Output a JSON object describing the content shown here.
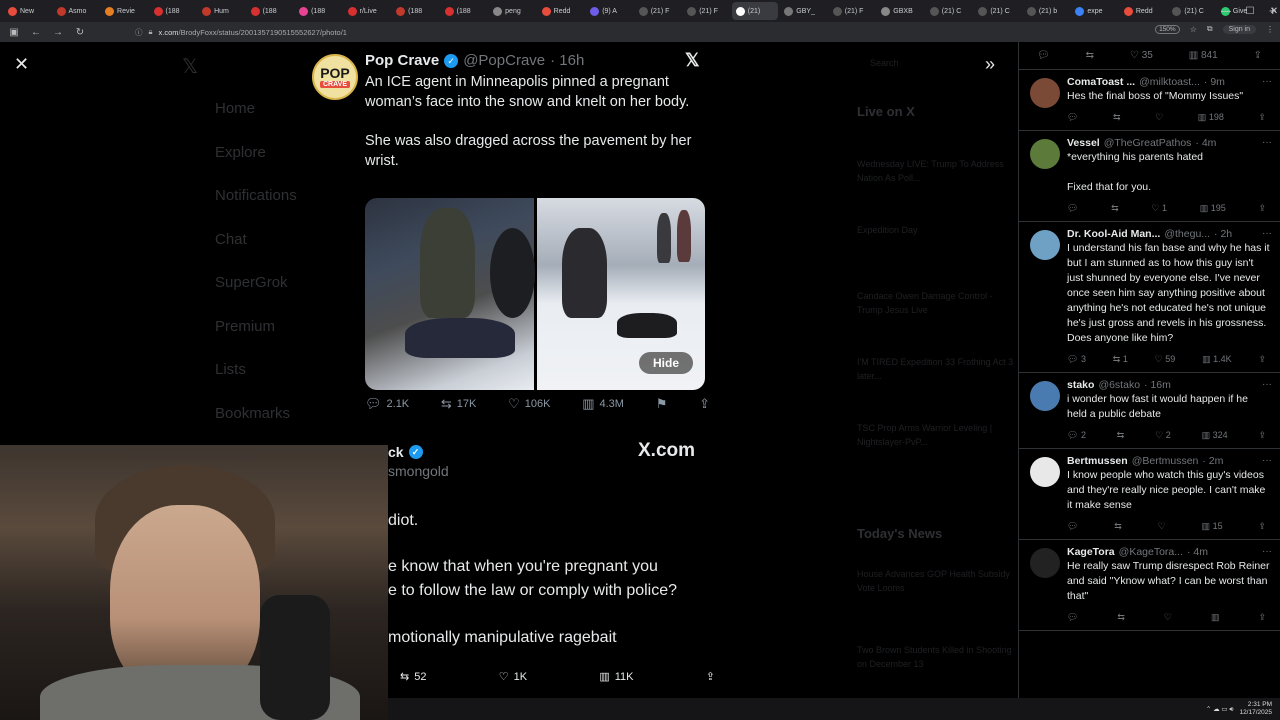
{
  "browser": {
    "tabs": [
      "New",
      "Asmo",
      "Revie",
      "(188",
      "Hum",
      "(188",
      "(188",
      "r/Live",
      "(188",
      "(188",
      "peng",
      "Redd",
      "(9) A",
      "(21) F",
      "(21) F",
      "(21)",
      "GBY_",
      "(21) F",
      "GBXB",
      "(21) C",
      "(21) C",
      "(21) b",
      "expe",
      "Redd",
      "(21) C",
      "Give"
    ],
    "active_tab_index": 15,
    "url_domain": "x.com",
    "url_path": "/BrodyFoxx/status/2001357190515552627/photo/1",
    "zoom": "150%",
    "signin_label": "Sign in"
  },
  "background": {
    "nav_items": [
      "Home",
      "Explore",
      "Notifications",
      "Chat",
      "SuperGrok",
      "Premium",
      "Lists",
      "Bookmarks"
    ],
    "search_label": "Search",
    "live_heading": "Live on X",
    "live_items": [
      "Wednesday LIVE: Trump To Address Nation As Poll...",
      "Expedition Day",
      "Candace Owen Damage Control - Trump Jesus Live",
      "I'M TIRED Expedition 33 Frothing Act 3 later...",
      "TSC Prop Arms Warrior Leveling | Nightslayer-PvP..."
    ],
    "news_heading": "Today's News",
    "news_items": [
      "House Advances GOP Health Subsidy Vote Looms",
      "Two Brown Students Killed in Shooting on December 13"
    ]
  },
  "tweet": {
    "name": "Pop Crave",
    "handle": "@PopCrave",
    "time": "· 16h",
    "avatar_text": "POP",
    "avatar_sub": "CRAVE",
    "text_1": "An ICE agent in Minneapolis pinned a pregnant woman’s face into the snow and knelt on her body.",
    "text_2": "She was also dragged across the pavement by her wrist.",
    "hide_label": "Hide",
    "replies": "2.1K",
    "reposts": "17K",
    "likes": "106K",
    "views": "4.3M"
  },
  "quote": {
    "name_fragment": "ck",
    "handle_fragment": "smongold",
    "brand": "X.com",
    "line1": "diot.",
    "line2": "e know that when you're pregnant you",
    "line3": "e to follow the law or comply with police?",
    "line4": "motionally manipulative ragebait",
    "reposts": "52",
    "likes": "1K",
    "views": "11K"
  },
  "replies_top": {
    "likes": "35",
    "views": "841"
  },
  "replies": [
    {
      "name": "ComaToast ...",
      "handle": "@milktoast...",
      "time": "· 9m",
      "text": "Hes the final boss of \"Mommy Issues\"",
      "replies": "",
      "reposts": "",
      "likes": "",
      "views": "198",
      "avatar_color": "#7a4a36"
    },
    {
      "name": "Vessel",
      "handle": "@TheGreatPathos",
      "time": "· 4m",
      "text": "*everything his parents hated\n\nFixed that for you.",
      "replies": "",
      "reposts": "",
      "likes": "1",
      "views": "195",
      "avatar_color": "#5c7a3a"
    },
    {
      "name": "Dr. Kool-Aid Man...",
      "handle": "@thegu...",
      "time": "· 2h",
      "text": "I understand his fan base and why he has it but I am stunned as to how this guy isn't just shunned by everyone else. I've never once seen him say anything positive about anything he's not educated he's not unique he's just gross and revels in his grossness. Does anyone like him?",
      "replies": "3",
      "reposts": "1",
      "likes": "59",
      "views": "1.4K",
      "avatar_color": "#6fa1c4"
    },
    {
      "name": "stako",
      "handle": "@6stako",
      "time": "· 16m",
      "text": "i wonder how fast it would happen if he held a public debate",
      "replies": "2",
      "reposts": "",
      "likes": "2",
      "views": "324",
      "avatar_color": "#4a7bb0"
    },
    {
      "name": "Bertmussen",
      "handle": "@Bertmussen",
      "time": "· 2m",
      "text": "I know people who watch this guy's videos and they're really nice people. I can't make it make sense",
      "replies": "",
      "reposts": "",
      "likes": "",
      "views": "15",
      "avatar_color": "#e8e8e8"
    },
    {
      "name": "KageTora",
      "handle": "@KageTora...",
      "time": "· 4m",
      "text": "He really saw Trump disrespect Rob Reiner and said \"Yknow what? I can be worst than that\"",
      "replies": "",
      "reposts": "",
      "likes": "",
      "views": "",
      "avatar_color": "#222222"
    }
  ],
  "taskbar": {
    "time": "2:31 PM",
    "date": "12/17/2025"
  }
}
